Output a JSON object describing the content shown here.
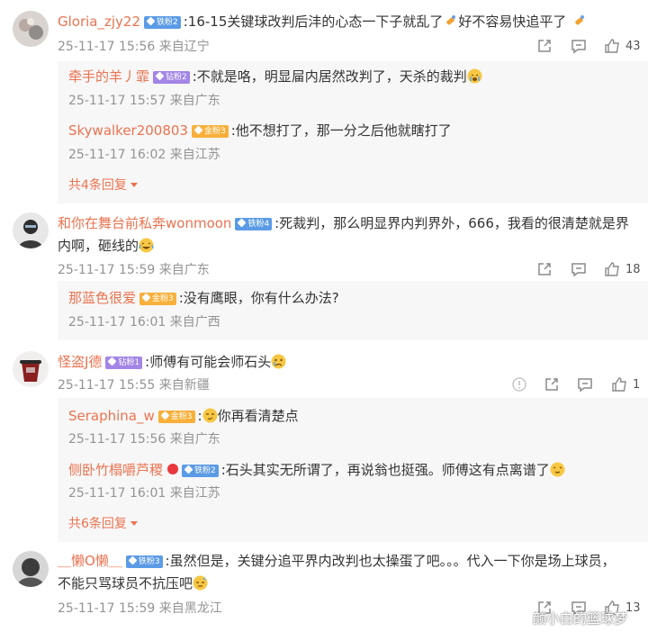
{
  "comments": [
    {
      "user": "Gloria_zjy22",
      "badge": "铁粉2",
      "text": ":16-15关键球改判后沣的心态一下子就乱了",
      "text2": "好不容易快追平了",
      "meta": "25-11-17 15:56 来自辽宁",
      "likes": "43",
      "replies": [
        {
          "user": "牵手的羊丿霏",
          "badge": "钻粉2",
          "text": ":不就是咯，明显屇内居然改判了，天杀的裁判",
          "meta": "25-11-17 15:57 来自广东"
        },
        {
          "user": "Skywalker200803",
          "badge": "金粉3",
          "text": ":他不想打了，那一分之后他就瞎打了",
          "meta": "25-11-17 16:02 来自江苏"
        }
      ],
      "more": "共4条回复"
    },
    {
      "user": "和你在舞台前私奔wonmoon",
      "badge": "铁粉4",
      "text": ":死裁判，那么明显界内判界外，666，我看的很清楚就是界",
      "text2": "内啊，砸线的",
      "meta": "25-11-17 15:59 来自广东",
      "likes": "18",
      "replies": [
        {
          "user": "那蓝色很爱",
          "badge": "金粉3",
          "text": ":没有鹰眼，你有什么办法?",
          "meta": "25-11-17 16:01 来自广西"
        }
      ]
    },
    {
      "user": "怪盗J德",
      "badge": "钻粉1",
      "text": ":师傅有可能会师石头",
      "meta": "25-11-17 15:55 来自新疆",
      "likes": "1",
      "replies": [
        {
          "user": "Seraphina_w",
          "badge": "金粉3",
          "text": ":",
          "text_b": "你再看清楚点",
          "meta": "25-11-17 15:56 来自广东"
        },
        {
          "user": "侧卧竹榻嚼芦稷",
          "badge": "铁粉2",
          "text": ":石头其实无所谓了，再说翁也挺强。师傅这有点离谱了",
          "meta": "25-11-17 16:01 来自江苏"
        }
      ],
      "more": "共6条回复"
    },
    {
      "user": "＿懒O懒＿",
      "badge": "铁粉3",
      "text": ":虽然但是，关键分追平界内改判也太操蛋了吧。。。代入一下你是场上球员，",
      "text2": "不能只骂球员不抗压吧",
      "meta": "25-11-17 15:59 来自黑龙江",
      "likes": "13"
    }
  ],
  "watermark": "颜小白的篮球梦",
  "colors": {
    "username": "#eb7350",
    "text": "#333333",
    "meta": "#939393",
    "reply_bg": "#f7f7f7"
  }
}
